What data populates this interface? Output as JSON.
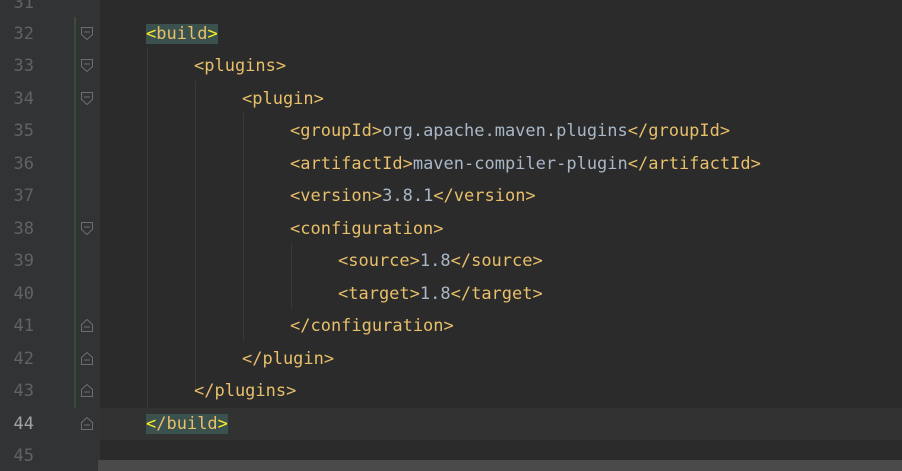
{
  "editor": {
    "language": "xml",
    "caret_line": "44",
    "lines": [
      {
        "number": "31",
        "text": ""
      },
      {
        "number": "32",
        "text": "<build>"
      },
      {
        "number": "33",
        "text": "<plugins>"
      },
      {
        "number": "34",
        "text": "<plugin>"
      },
      {
        "number": "35",
        "text": "<groupId>org.apache.maven.plugins</groupId>"
      },
      {
        "number": "36",
        "text": "<artifactId>maven-compiler-plugin</artifactId>"
      },
      {
        "number": "37",
        "text": "<version>3.8.1</version>"
      },
      {
        "number": "38",
        "text": "<configuration>"
      },
      {
        "number": "39",
        "text": "<source>1.8</source>"
      },
      {
        "number": "40",
        "text": "<target>1.8</target>"
      },
      {
        "number": "41",
        "text": "</configuration>"
      },
      {
        "number": "42",
        "text": "</plugin>"
      },
      {
        "number": "43",
        "text": "</plugins>"
      },
      {
        "number": "44",
        "text": "</build>"
      },
      {
        "number": "45",
        "text": ""
      }
    ],
    "tokens": {
      "build_open": "build",
      "build_close": "/build",
      "plugins_open": "<plugins>",
      "plugin_open": "<plugin>",
      "groupId_open": "<groupId>",
      "groupId_value": "org.apache.maven.plugins",
      "groupId_close": "</groupId>",
      "artifactId_open": "<artifactId>",
      "artifactId_value": "maven-compiler-plugin",
      "artifactId_close": "</artifactId>",
      "version_open": "<version>",
      "version_value": "3.8.1",
      "version_close": "</version>",
      "configuration_open": "<configuration>",
      "source_open": "<source>",
      "source_value": "1.8",
      "source_close": "</source>",
      "target_open": "<target>",
      "target_value": "1.8",
      "target_close": "</target>",
      "configuration_close": "</configuration>",
      "plugin_close": "</plugin>",
      "plugins_close": "</plugins>"
    },
    "colors": {
      "background": "#2b2b2b",
      "gutter": "#313335",
      "line_number": "#606366",
      "tag": "#e8bf6a",
      "text": "#a9b7c6",
      "matched_tag_background": "#3b514d",
      "matched_bracket": "#ffef28"
    }
  }
}
